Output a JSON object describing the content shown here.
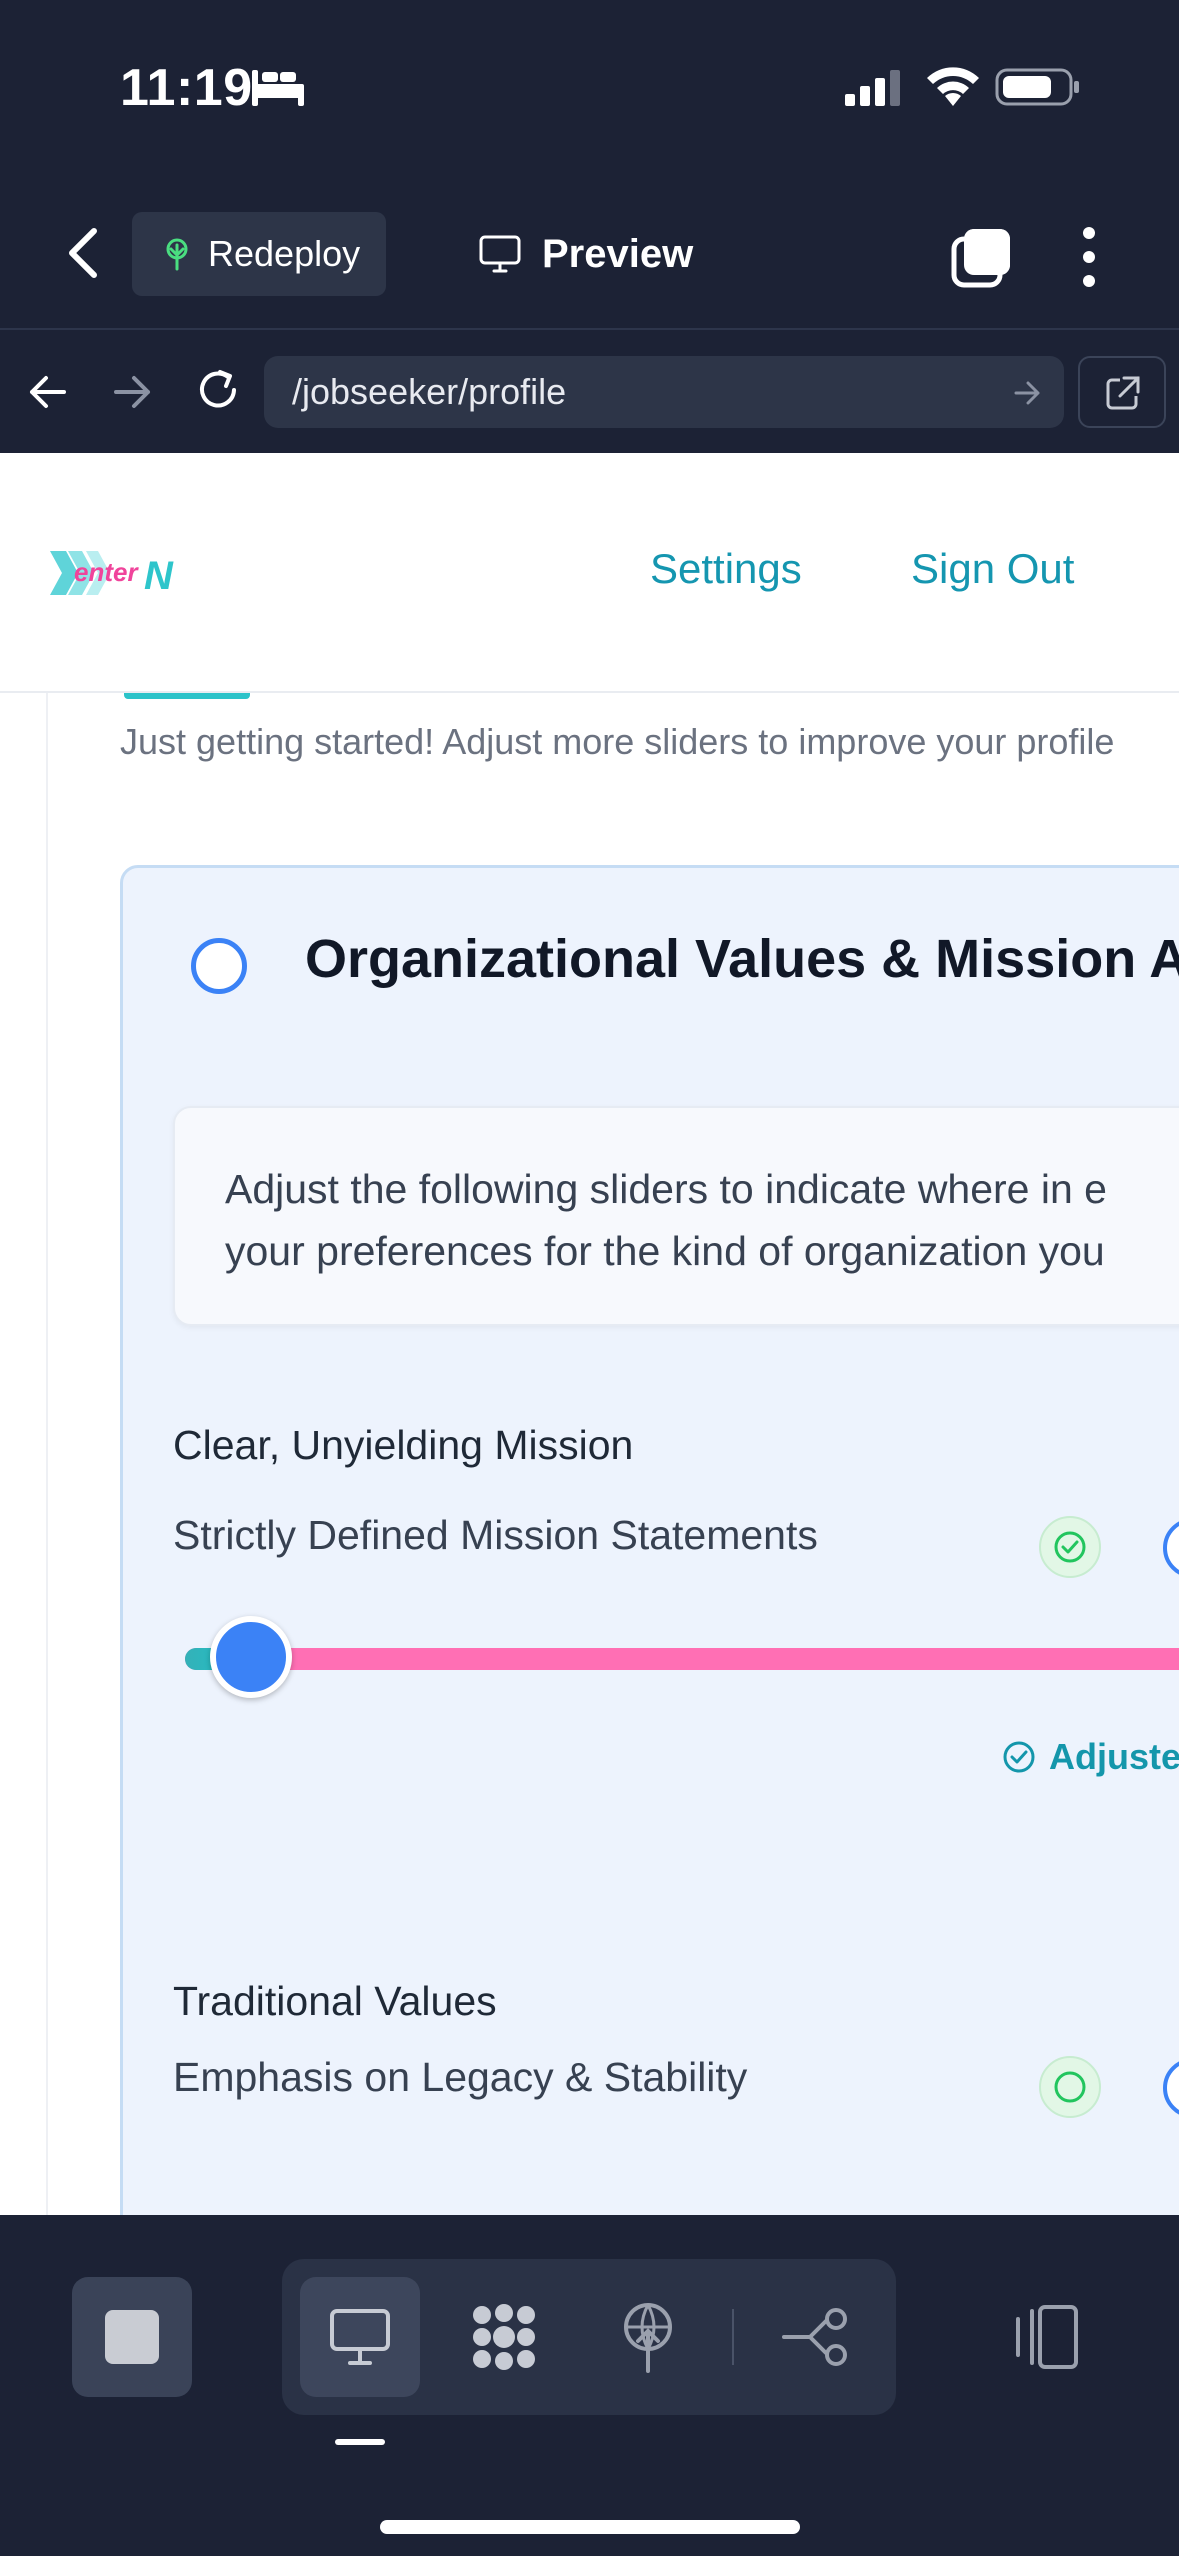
{
  "status_bar": {
    "time": "11:19",
    "icons": [
      "sleep-icon",
      "cellular-signal-icon",
      "wifi-icon",
      "battery-icon"
    ]
  },
  "app_header": {
    "redeploy_label": "Redeploy",
    "preview_label": "Preview",
    "icons": [
      "back-chevron-icon",
      "sprout-icon",
      "monitor-icon",
      "tabs-icon",
      "more-vertical-icon"
    ]
  },
  "browser": {
    "url": "/jobseeker/profile",
    "icons": [
      "arrow-left-icon",
      "arrow-right-icon",
      "reload-icon",
      "go-arrow-icon",
      "external-link-icon"
    ]
  },
  "site_nav": {
    "logo_text": "enterN",
    "settings_label": "Settings",
    "signout_label": "Sign Out"
  },
  "profile": {
    "progress_hint": "Just getting started! Adjust more sliders to improve your profile",
    "section": {
      "title": "Organizational Values & Mission A",
      "intro_line1": "Adjust the following sliders to indicate where in e",
      "intro_line2": "your preferences for the kind of organization you",
      "groups": [
        {
          "heading": "Clear, Unyielding Mission",
          "slider_label": "Strictly Defined Mission Statements",
          "value_fraction": 0.06,
          "status": "Adjuste"
        },
        {
          "heading": "Traditional Values",
          "slider_label": "Emphasis on Legacy & Stability"
        }
      ],
      "help_glyph": "?"
    }
  },
  "colors": {
    "brand_teal": "#1596b0",
    "slider_pink": "#ff6fb4",
    "thumb_blue": "#3b82f6",
    "chrome_dark": "#1c2235"
  },
  "bottom_toolbar": {
    "icons": [
      "stop-icon",
      "desktop-icon",
      "grid-dots-icon",
      "deploy-globe-icon",
      "workflow-icon",
      "layout-toggle-icon"
    ]
  }
}
